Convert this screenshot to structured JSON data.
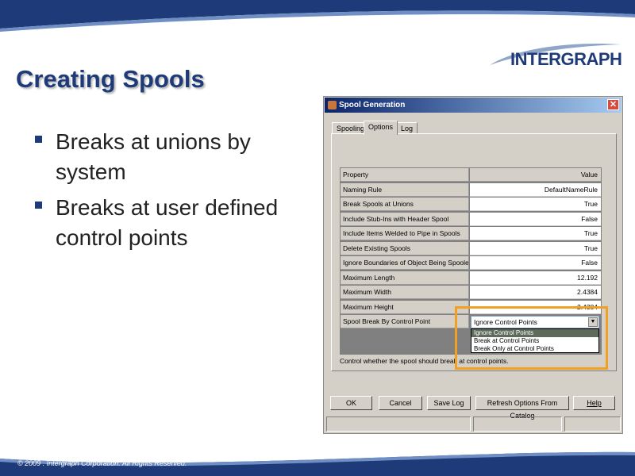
{
  "slide": {
    "title": "Creating Spools",
    "logo_text": "INTERGRAPH",
    "bullets": [
      "Breaks at unions by system",
      "Breaks at user defined control points"
    ],
    "copyright": "© 2009 . Intergraph Corporation. All Rights Reserved.",
    "brand_color": "#1f3a78"
  },
  "dialog": {
    "title": "Spool Generation",
    "tabs": [
      "Spooling",
      "Options",
      "Log"
    ],
    "active_tab": "Options",
    "grid_header": {
      "property": "Property",
      "value": "Value"
    },
    "rows": [
      {
        "property": "Naming Rule",
        "value": "DefaultNameRule"
      },
      {
        "property": "Break Spools at Unions",
        "value": "True"
      },
      {
        "property": "Include Stub-Ins with Header Spool",
        "value": "False"
      },
      {
        "property": "Include Items Welded to Pipe in Spools",
        "value": "True"
      },
      {
        "property": "Delete Existing Spools",
        "value": "True"
      },
      {
        "property": "Ignore Boundaries of Object Being Spooled",
        "value": "False"
      },
      {
        "property": "Maximum Length",
        "value": "12.192"
      },
      {
        "property": "Maximum Width",
        "value": "2.4384"
      },
      {
        "property": "Maximum Height",
        "value": "2.4384"
      }
    ],
    "dropdown_row": {
      "property": "Spool Break By Control Point",
      "selected": "Ignore Control Points",
      "options": [
        "Ignore Control Points",
        "Break at Control Points",
        "Break Only at Control Points"
      ]
    },
    "description": "Control whether the spool should break at control points.",
    "buttons": {
      "ok": "OK",
      "cancel": "Cancel",
      "save_log": "Save Log",
      "refresh": "Refresh Options From Catalog",
      "help": "Help"
    },
    "highlight_color": "#f0a022"
  }
}
